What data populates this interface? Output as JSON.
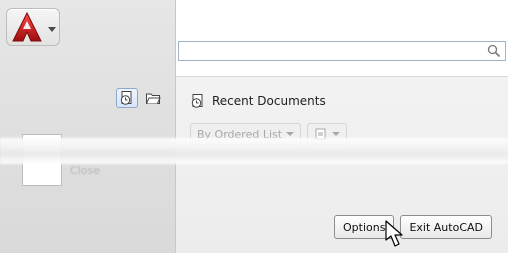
{
  "right": {
    "search": {
      "value": "",
      "placeholder": ""
    },
    "recent": {
      "title": "Recent Documents",
      "sort_label": "By Ordered List"
    },
    "buttons": {
      "options": "Options",
      "exit": "Exit AutoCAD"
    }
  },
  "left": {
    "blurred_item_label": "Close"
  },
  "icons": {
    "app": "autocad-logo-icon",
    "chevron": "chevron-down-icon",
    "recent": "recent-documents-icon",
    "open": "open-documents-icon",
    "search": "search-icon",
    "cursor": "mouse-pointer-icon"
  },
  "colors": {
    "logo_red": "#c91f1f",
    "active_blue": "#8fa7c9"
  }
}
